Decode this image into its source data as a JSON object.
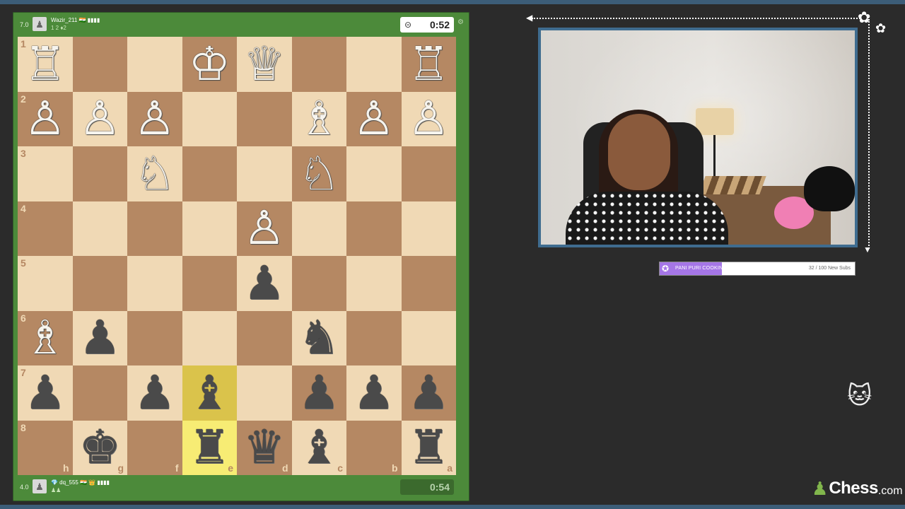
{
  "top_player": {
    "rating": "7.0",
    "name": "Wazir_211 🇮🇳 ▮▮▮▮",
    "meta": "1 2 ♦2",
    "clock": "0:52"
  },
  "bottom_player": {
    "rating": "4.0",
    "name": "💎 dq_555 🇮🇳 👑 ▮▮▮▮",
    "meta": "♟♟",
    "clock": "0:54"
  },
  "board": {
    "ranks": [
      "1",
      "2",
      "3",
      "4",
      "5",
      "6",
      "7",
      "8"
    ],
    "files": [
      "h",
      "g",
      "f",
      "e",
      "d",
      "c",
      "b",
      "a"
    ],
    "highlighted": [
      "e7",
      "e8"
    ],
    "pieces": [
      [
        "♖",
        "",
        "",
        "♔",
        "♕",
        "",
        "",
        "♖"
      ],
      [
        "♙",
        "♙",
        "♙",
        "",
        "",
        "♗",
        "♙",
        "♙"
      ],
      [
        "",
        "",
        "♘",
        "",
        "",
        "♘",
        "",
        ""
      ],
      [
        "",
        "",
        "",
        "",
        "♙",
        "",
        "",
        ""
      ],
      [
        "",
        "",
        "",
        "",
        "♟",
        "",
        "",
        ""
      ],
      [
        "♗",
        "♟",
        "",
        "",
        "",
        "♞",
        "",
        ""
      ],
      [
        "♟",
        "",
        "♟",
        "♝",
        "",
        "♟",
        "♟",
        "♟"
      ],
      [
        "",
        "♚",
        "",
        "♜",
        "♛",
        "♝",
        "",
        "♜"
      ]
    ],
    "colors": [
      [
        "w",
        "",
        "",
        "w",
        "w",
        "",
        "",
        "w"
      ],
      [
        "w",
        "w",
        "w",
        "",
        "",
        "w",
        "w",
        "w"
      ],
      [
        "",
        "",
        "w",
        "",
        "",
        "w",
        "",
        ""
      ],
      [
        "",
        "",
        "",
        "",
        "w",
        "",
        "",
        ""
      ],
      [
        "",
        "",
        "",
        "",
        "b",
        "",
        "",
        ""
      ],
      [
        "w",
        "b",
        "",
        "",
        "",
        "b",
        "",
        ""
      ],
      [
        "b",
        "",
        "b",
        "b",
        "",
        "b",
        "b",
        "b"
      ],
      [
        "",
        "b",
        "",
        "b",
        "b",
        "b",
        "",
        "b"
      ]
    ]
  },
  "sub_goal": {
    "title": "PANI PURI COOKING STREAM",
    "count": "32 / 100 New Subs",
    "progress": 0.32
  },
  "brand": {
    "name": "Chess",
    "tld": ".com"
  },
  "colors": {
    "panel_green": "#4c8a3a",
    "light_square": "#f0d9b5",
    "dark_square": "#b58863",
    "highlight": "#f7ec74",
    "webcam_border": "#3f6c8f",
    "subbar_fill": "#a576e6"
  }
}
